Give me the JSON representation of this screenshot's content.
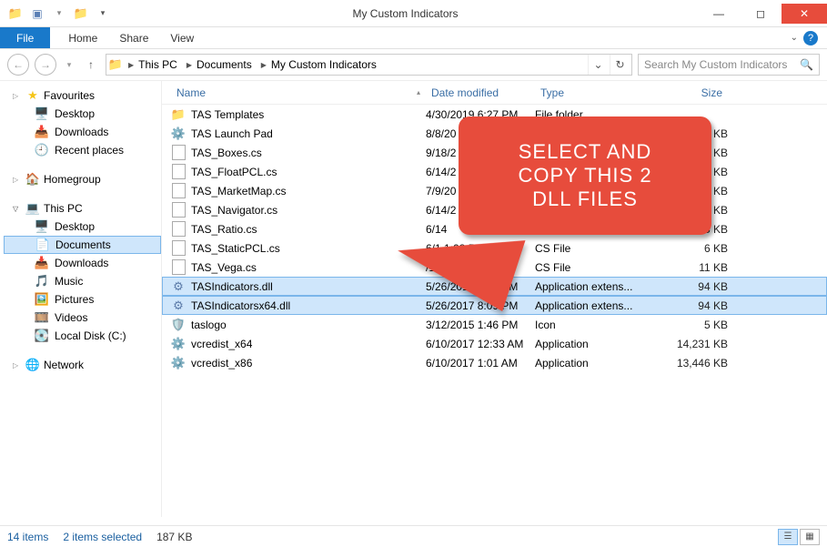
{
  "window": {
    "title": "My Custom Indicators"
  },
  "tabs": {
    "file": "File",
    "home": "Home",
    "share": "Share",
    "view": "View"
  },
  "breadcrumbs": {
    "root": "This PC",
    "documents": "Documents",
    "folder": "My Custom Indicators"
  },
  "search": {
    "placeholder": "Search My Custom Indicators"
  },
  "sidebar": {
    "favourites": {
      "label": "Favourites",
      "items": [
        "Desktop",
        "Downloads",
        "Recent places"
      ]
    },
    "homegroup": {
      "label": "Homegroup"
    },
    "thispc": {
      "label": "This PC",
      "items": [
        "Desktop",
        "Documents",
        "Downloads",
        "Music",
        "Pictures",
        "Videos",
        "Local Disk (C:)"
      ]
    },
    "network": {
      "label": "Network"
    }
  },
  "columns": {
    "name": "Name",
    "date": "Date modified",
    "type": "Type",
    "size": "Size"
  },
  "files": [
    {
      "name": "TAS Templates",
      "date": "4/30/2019 6:27 PM",
      "type": "File folder",
      "size": "",
      "icon": "folder",
      "selected": false
    },
    {
      "name": "TAS Launch Pad",
      "date": "8/8/20",
      "type": "",
      "size": "48 KB",
      "icon": "exe",
      "selected": false
    },
    {
      "name": "TAS_Boxes.cs",
      "date": "9/18/2",
      "type": "",
      "size": "6 KB",
      "icon": "cs",
      "selected": false
    },
    {
      "name": "TAS_FloatPCL.cs",
      "date": "6/14/2",
      "type": "",
      "size": "7 KB",
      "icon": "cs",
      "selected": false
    },
    {
      "name": "TAS_MarketMap.cs",
      "date": "7/9/20",
      "type": "",
      "size": "8 KB",
      "icon": "cs",
      "selected": false
    },
    {
      "name": "TAS_Navigator.cs",
      "date": "6/14/2",
      "type": "",
      "size": "7 KB",
      "icon": "cs",
      "selected": false
    },
    {
      "name": "TAS_Ratio.cs",
      "date": "6/14",
      "type": "",
      "size": "5 KB",
      "icon": "cs",
      "selected": false
    },
    {
      "name": "TAS_StaticPCL.cs",
      "date": "6/1         1:08 PM",
      "type": "CS File",
      "size": "6 KB",
      "icon": "cs",
      "selected": false
    },
    {
      "name": "TAS_Vega.cs",
      "date": "  /14/2018 7:08 PM",
      "type": "CS File",
      "size": "11 KB",
      "icon": "cs",
      "selected": false
    },
    {
      "name": "TASIndicators.dll",
      "date": "5/26/2017 8:09 PM",
      "type": "Application extens...",
      "size": "94 KB",
      "icon": "dll",
      "selected": true
    },
    {
      "name": "TASIndicatorsx64.dll",
      "date": "5/26/2017 8:09 PM",
      "type": "Application extens...",
      "size": "94 KB",
      "icon": "dll",
      "selected": true
    },
    {
      "name": "taslogo",
      "date": "3/12/2015 1:46 PM",
      "type": "Icon",
      "size": "5 KB",
      "icon": "ico",
      "selected": false
    },
    {
      "name": "vcredist_x64",
      "date": "6/10/2017 12:33 AM",
      "type": "Application",
      "size": "14,231 KB",
      "icon": "exe",
      "selected": false
    },
    {
      "name": "vcredist_x86",
      "date": "6/10/2017 1:01 AM",
      "type": "Application",
      "size": "13,446 KB",
      "icon": "exe",
      "selected": false
    }
  ],
  "status": {
    "count": "14 items",
    "selection": "2 items selected",
    "size": "187 KB"
  },
  "callout": {
    "line1": "SELECT AND",
    "line2": "COPY THIS 2",
    "line3": "DLL FILES"
  }
}
